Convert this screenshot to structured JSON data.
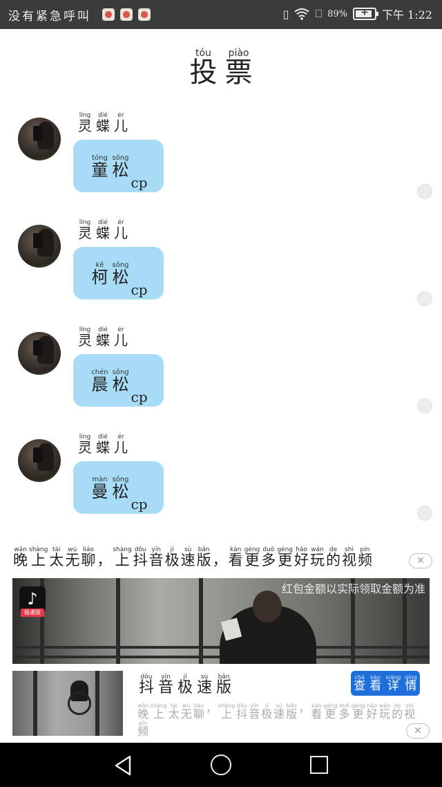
{
  "status_bar": {
    "left_text": "没有紧急呼叫",
    "battery_percent": "89%",
    "battery_level": 0.89,
    "time": "下午 1:22",
    "icons": [
      "vibrate-icon",
      "wifi-icon",
      "alert-icon",
      "battery-charging-icon"
    ]
  },
  "title": {
    "chars": [
      {
        "hz": "投",
        "py": "tóu"
      },
      {
        "hz": "票",
        "py": "piào"
      }
    ]
  },
  "sender": {
    "chars": [
      {
        "hz": "灵",
        "py": "líng"
      },
      {
        "hz": "蝶",
        "py": "dié"
      },
      {
        "hz": "儿",
        "py": "ér"
      }
    ]
  },
  "options": [
    {
      "chars": [
        {
          "hz": "童",
          "py": "tóng"
        },
        {
          "hz": "松",
          "py": "sōng"
        }
      ],
      "suffix": "cp"
    },
    {
      "chars": [
        {
          "hz": "柯",
          "py": "kē"
        },
        {
          "hz": "松",
          "py": "sōng"
        }
      ],
      "suffix": "cp"
    },
    {
      "chars": [
        {
          "hz": "晨",
          "py": "chén"
        },
        {
          "hz": "松",
          "py": "sōng"
        }
      ],
      "suffix": "cp"
    },
    {
      "chars": [
        {
          "hz": "曼",
          "py": "màn"
        },
        {
          "hz": "松",
          "py": "sōng"
        }
      ],
      "suffix": "cp"
    }
  ],
  "ad": {
    "headline": [
      {
        "hz": "晚",
        "py": "wǎn"
      },
      {
        "hz": "上",
        "py": "shàng"
      },
      {
        "hz": "太",
        "py": "tài"
      },
      {
        "hz": "无",
        "py": "wú"
      },
      {
        "hz": "聊",
        "py": "liáo"
      },
      {
        "hz": "，",
        "py": ""
      },
      {
        "hz": "上",
        "py": "shàng"
      },
      {
        "hz": "抖",
        "py": "dǒu"
      },
      {
        "hz": "音",
        "py": "yīn"
      },
      {
        "hz": "极",
        "py": "jí"
      },
      {
        "hz": "速",
        "py": "sù"
      },
      {
        "hz": "版",
        "py": "bǎn"
      },
      {
        "hz": "，",
        "py": ""
      },
      {
        "hz": "看",
        "py": "kàn"
      },
      {
        "hz": "更",
        "py": "gèng"
      },
      {
        "hz": "多",
        "py": "duō"
      },
      {
        "hz": "更",
        "py": "gèng"
      },
      {
        "hz": "好",
        "py": "hǎo"
      },
      {
        "hz": "玩",
        "py": "wán"
      },
      {
        "hz": "的",
        "py": "de"
      },
      {
        "hz": "视",
        "py": "shì"
      },
      {
        "hz": "频",
        "py": "pín"
      }
    ],
    "close_symbol": "✕",
    "banner_text": "红包金额以实际领取金额为准",
    "logo_tag": "极速版",
    "app_name": [
      {
        "hz": "抖",
        "py": "dǒu"
      },
      {
        "hz": "音",
        "py": "yīn"
      },
      {
        "hz": "极",
        "py": "jí"
      },
      {
        "hz": "速",
        "py": "sù"
      },
      {
        "hz": "版",
        "py": "bǎn"
      }
    ],
    "description": [
      {
        "hz": "晚",
        "py": "wǎn"
      },
      {
        "hz": "上",
        "py": "shàng"
      },
      {
        "hz": "太",
        "py": "tài"
      },
      {
        "hz": "无",
        "py": "wú"
      },
      {
        "hz": "聊",
        "py": "liáo"
      },
      {
        "hz": "，",
        "py": ""
      },
      {
        "hz": "上",
        "py": "shàng"
      },
      {
        "hz": "抖",
        "py": "dǒu"
      },
      {
        "hz": "音",
        "py": "yīn"
      },
      {
        "hz": "极",
        "py": "jí"
      },
      {
        "hz": "速",
        "py": "sù"
      },
      {
        "hz": "版",
        "py": "bǎn"
      },
      {
        "hz": "，",
        "py": ""
      },
      {
        "hz": "看",
        "py": "kàn"
      },
      {
        "hz": "更",
        "py": "gèng"
      },
      {
        "hz": "多",
        "py": "duō"
      },
      {
        "hz": "更",
        "py": "gèng"
      },
      {
        "hz": "好",
        "py": "hǎo"
      },
      {
        "hz": "玩",
        "py": "wán"
      },
      {
        "hz": "的",
        "py": "de"
      },
      {
        "hz": "视",
        "py": "shì"
      },
      {
        "hz": "频",
        "py": "pín"
      }
    ],
    "button": [
      {
        "hz": "查",
        "py": "chá"
      },
      {
        "hz": "看",
        "py": "kàn"
      },
      {
        "hz": "详",
        "py": "xiáng"
      },
      {
        "hz": "情",
        "py": "qíng"
      }
    ]
  },
  "nav": {
    "back": "back-icon",
    "home": "home-icon",
    "recent": "recent-apps-icon"
  }
}
